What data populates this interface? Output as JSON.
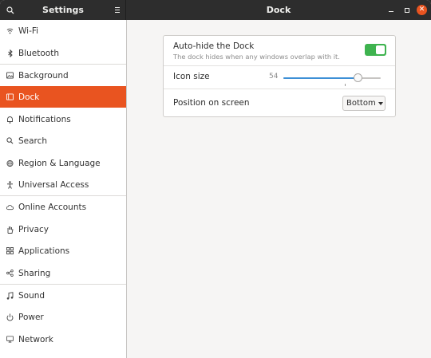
{
  "header": {
    "app_title": "Settings",
    "page_title": "Dock",
    "close_glyph": "✕"
  },
  "sidebar": {
    "items": [
      {
        "label": "Wi-Fi",
        "icon": "wifi-icon"
      },
      {
        "label": "Bluetooth",
        "icon": "bluetooth-icon"
      },
      {
        "label": "Background",
        "icon": "background-icon"
      },
      {
        "label": "Dock",
        "icon": "dock-icon",
        "selected": true
      },
      {
        "label": "Notifications",
        "icon": "notifications-icon"
      },
      {
        "label": "Search",
        "icon": "search-icon"
      },
      {
        "label": "Region & Language",
        "icon": "globe-icon"
      },
      {
        "label": "Universal Access",
        "icon": "accessibility-icon"
      },
      {
        "label": "Online Accounts",
        "icon": "cloud-icon"
      },
      {
        "label": "Privacy",
        "icon": "privacy-hand-icon"
      },
      {
        "label": "Applications",
        "icon": "applications-icon"
      },
      {
        "label": "Sharing",
        "icon": "share-icon"
      },
      {
        "label": "Sound",
        "icon": "music-note-icon"
      },
      {
        "label": "Power",
        "icon": "power-icon"
      },
      {
        "label": "Network",
        "icon": "network-icon"
      }
    ]
  },
  "dock": {
    "autohide": {
      "title": "Auto-hide the Dock",
      "subtitle": "The dock hides when any windows overlap with it.",
      "enabled": true
    },
    "icon_size": {
      "label": "Icon size",
      "value": "54",
      "fraction": 0.79
    },
    "position": {
      "label": "Position on screen",
      "selected": "Bottom"
    }
  },
  "colors": {
    "accent": "#e95420",
    "switch_on": "#3eb34f",
    "slider_fill": "#3d8fd6"
  }
}
